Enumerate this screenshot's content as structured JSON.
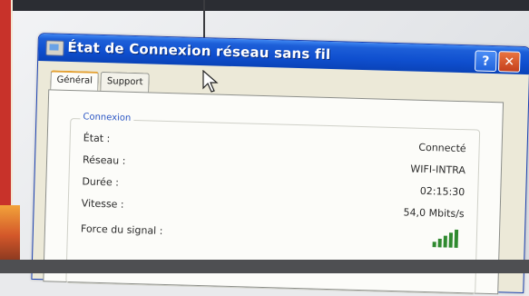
{
  "window": {
    "title": "État de Connexion réseau sans fil",
    "help_label": "?",
    "close_label": "✕"
  },
  "tabs": [
    {
      "label": "Général",
      "active": true
    },
    {
      "label": "Support",
      "active": false
    }
  ],
  "connection": {
    "group_label": "Connexion",
    "rows": [
      {
        "label": "État :",
        "value": "Connecté"
      },
      {
        "label": "Réseau :",
        "value": "WIFI-INTRA"
      },
      {
        "label": "Durée :",
        "value": "02:15:30"
      },
      {
        "label": "Vitesse :",
        "value": "54,0 Mbits/s"
      },
      {
        "label": "Force du signal :",
        "value": ""
      }
    ],
    "signal_bars_filled": 5,
    "signal_bars_total": 5
  },
  "colors": {
    "titlebar": "#0f4fcf",
    "signal": "#2f8a2f"
  }
}
